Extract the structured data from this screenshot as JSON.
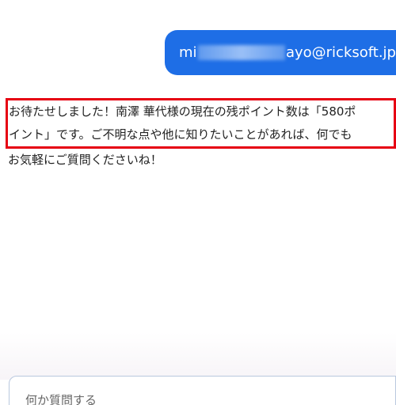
{
  "chat": {
    "user_message": {
      "prefix": "mi",
      "suffix": "ayo@ricksoft.jp"
    },
    "assistant_message": {
      "line1": "お待たせしました！南澤 華代様の現在の残ポイント数は「580ポ",
      "line2": "イント」です。ご不明な点や他に知りたいことがあれば、何でも",
      "line3": "お気軽にご質問くださいね！"
    }
  },
  "composer": {
    "placeholder": "何か質問する"
  },
  "colors": {
    "user_bubble": "#1e6ee6",
    "highlight_border": "#e60012"
  }
}
